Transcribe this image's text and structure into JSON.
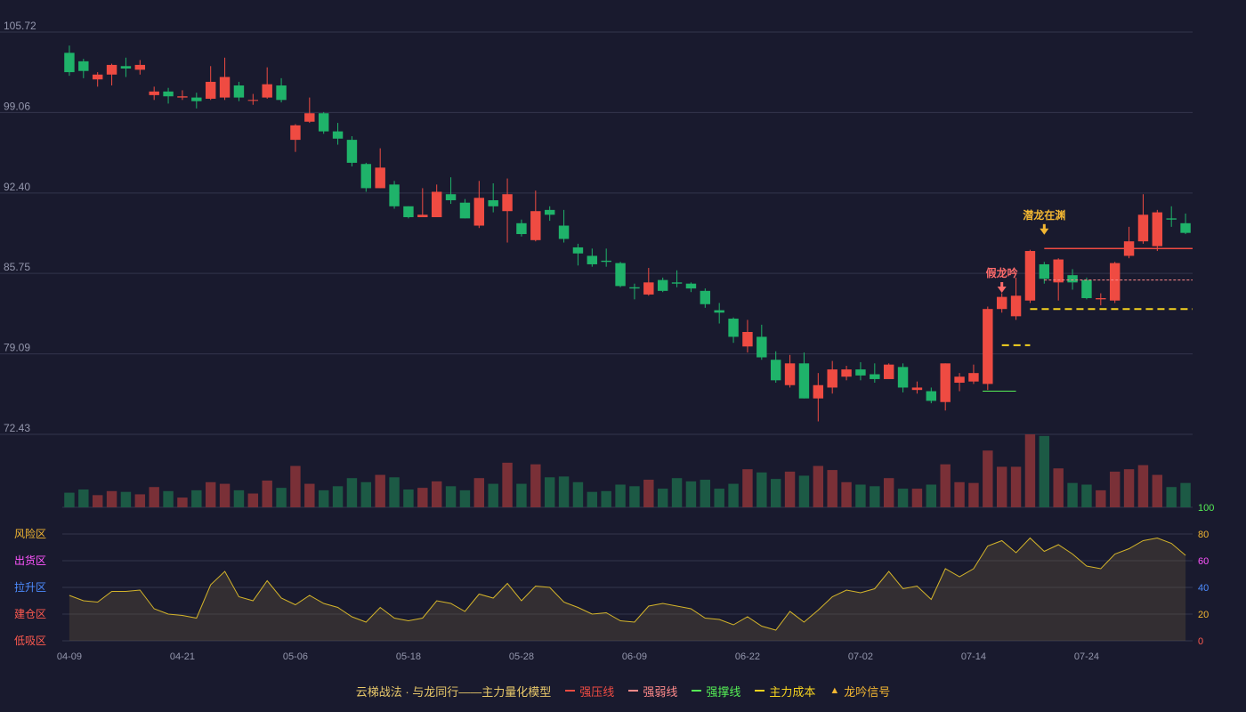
{
  "chart_data": {
    "type": "candlestick",
    "x": [
      "04-09",
      "04-10",
      "04-11",
      "04-12",
      "04-15",
      "04-16",
      "04-17",
      "04-18",
      "04-19",
      "04-22",
      "04-23",
      "04-24",
      "04-25",
      "04-26",
      "04-29",
      "04-30",
      "05-06",
      "05-07",
      "05-08",
      "05-09",
      "05-10",
      "05-13",
      "05-14",
      "05-15",
      "05-16",
      "05-17",
      "05-20",
      "05-21",
      "05-22",
      "05-23",
      "05-24",
      "05-27",
      "05-28",
      "05-29",
      "05-30",
      "05-31",
      "06-03",
      "06-04",
      "06-05",
      "06-06",
      "06-07",
      "06-11",
      "06-12",
      "06-13",
      "06-14",
      "06-17",
      "06-18",
      "06-19",
      "06-20",
      "06-21",
      "06-24",
      "06-25",
      "06-26",
      "06-27",
      "06-28",
      "07-01",
      "07-02",
      "07-03",
      "07-04",
      "07-05",
      "07-08",
      "07-09",
      "07-10",
      "07-11",
      "07-12",
      "07-15",
      "07-16",
      "07-17",
      "07-18",
      "07-19",
      "07-22",
      "07-23",
      "07-24",
      "07-25",
      "07-26",
      "07-29",
      "07-30",
      "07-31",
      "08-01",
      "08-02",
      "08-05",
      "08-06",
      "08-07",
      "08-08",
      "08-09"
    ],
    "x_ticks": [
      "04-09",
      "04-21",
      "05-06",
      "05-18",
      "05-28",
      "06-09",
      "06-22",
      "07-02",
      "07-14",
      "07-24"
    ],
    "x_tick_index": [
      0,
      8,
      16,
      24,
      32,
      40,
      48,
      56,
      64,
      72
    ],
    "candles": [
      [
        104.0,
        102.4,
        104.6,
        102.1
      ],
      [
        103.3,
        102.5,
        103.5,
        101.9
      ],
      [
        101.8,
        102.2,
        102.4,
        101.2
      ],
      [
        102.2,
        103.0,
        103.1,
        101.3
      ],
      [
        102.9,
        102.7,
        103.6,
        102.0
      ],
      [
        102.6,
        103.0,
        103.4,
        102.2
      ],
      [
        100.5,
        100.8,
        101.2,
        100.1
      ],
      [
        100.8,
        100.4,
        101.1,
        99.8
      ],
      [
        100.3,
        100.4,
        100.9,
        100.1
      ],
      [
        100.3,
        100.0,
        100.7,
        99.4
      ],
      [
        100.2,
        101.6,
        102.9,
        100.1
      ],
      [
        100.3,
        102.0,
        103.6,
        100.1
      ],
      [
        101.3,
        100.3,
        101.6,
        100.0
      ],
      [
        100.1,
        100.1,
        100.6,
        99.7
      ],
      [
        100.3,
        101.4,
        102.8,
        100.2
      ],
      [
        101.3,
        100.1,
        101.9,
        99.9
      ],
      [
        96.8,
        98.0,
        98.1,
        95.8
      ],
      [
        98.3,
        99.0,
        100.3,
        98.2
      ],
      [
        99.0,
        97.5,
        99.1,
        97.3
      ],
      [
        97.5,
        96.9,
        98.2,
        96.4
      ],
      [
        96.8,
        94.9,
        97.1,
        94.6
      ],
      [
        94.8,
        92.8,
        94.9,
        92.5
      ],
      [
        92.8,
        94.5,
        96.1,
        92.8
      ],
      [
        93.1,
        91.3,
        93.4,
        91.1
      ],
      [
        91.3,
        90.4,
        91.3,
        90.3
      ],
      [
        90.4,
        90.6,
        92.8,
        90.4
      ],
      [
        90.4,
        92.5,
        93.1,
        90.4
      ],
      [
        92.3,
        91.8,
        93.7,
        91.5
      ],
      [
        91.6,
        90.3,
        91.9,
        90.3
      ],
      [
        89.7,
        92.0,
        93.4,
        89.5
      ],
      [
        91.8,
        91.3,
        93.2,
        90.8
      ],
      [
        90.9,
        92.3,
        93.6,
        88.3
      ],
      [
        89.9,
        89.0,
        90.2,
        88.8
      ],
      [
        88.5,
        90.9,
        92.6,
        88.4
      ],
      [
        91.0,
        90.6,
        91.3,
        90.1
      ],
      [
        89.7,
        88.6,
        91.0,
        88.3
      ],
      [
        87.9,
        87.4,
        88.2,
        86.4
      ],
      [
        87.2,
        86.5,
        87.8,
        86.3
      ],
      [
        86.8,
        86.7,
        87.8,
        86.3
      ],
      [
        86.6,
        84.7,
        86.7,
        84.6
      ],
      [
        84.6,
        84.5,
        84.9,
        83.6
      ],
      [
        84.0,
        85.0,
        86.2,
        83.9
      ],
      [
        85.2,
        84.3,
        85.4,
        84.2
      ],
      [
        85.0,
        84.9,
        86.0,
        84.6
      ],
      [
        84.9,
        84.5,
        85.0,
        84.2
      ],
      [
        84.3,
        83.2,
        84.5,
        82.9
      ],
      [
        82.7,
        82.5,
        83.3,
        81.6
      ],
      [
        82.0,
        80.5,
        82.1,
        80.0
      ],
      [
        79.7,
        80.9,
        81.9,
        79.2
      ],
      [
        80.5,
        78.8,
        81.5,
        78.6
      ],
      [
        78.6,
        76.9,
        79.3,
        76.7
      ],
      [
        76.5,
        78.3,
        79.0,
        76.3
      ],
      [
        78.3,
        75.4,
        79.2,
        75.4
      ],
      [
        75.4,
        76.5,
        77.5,
        73.5
      ],
      [
        76.3,
        77.8,
        78.5,
        75.8
      ],
      [
        77.2,
        77.8,
        78.1,
        76.9
      ],
      [
        77.8,
        77.3,
        78.4,
        76.9
      ],
      [
        77.4,
        77.0,
        78.3,
        76.7
      ],
      [
        77.0,
        78.2,
        78.3,
        77.1
      ],
      [
        78.0,
        76.3,
        78.3,
        75.9
      ],
      [
        76.1,
        76.3,
        76.8,
        75.8
      ],
      [
        76.0,
        75.2,
        76.3,
        75.0
      ],
      [
        75.1,
        78.3,
        78.3,
        74.4
      ],
      [
        76.7,
        77.2,
        77.5,
        76.0
      ],
      [
        76.8,
        77.5,
        78.2,
        76.6
      ],
      [
        76.6,
        82.8,
        83.0,
        76.1
      ],
      [
        82.8,
        83.8,
        84.1,
        82.5
      ],
      [
        82.2,
        83.9,
        85.4,
        81.9
      ],
      [
        83.5,
        87.6,
        87.7,
        83.3
      ],
      [
        86.5,
        85.3,
        86.7,
        84.9
      ],
      [
        85.0,
        86.9,
        87.0,
        83.5
      ],
      [
        85.6,
        85.0,
        86.1,
        84.4
      ],
      [
        85.2,
        83.7,
        85.4,
        83.6
      ],
      [
        83.6,
        83.7,
        84.1,
        83.1
      ],
      [
        83.5,
        86.6,
        86.7,
        83.3
      ],
      [
        87.2,
        88.4,
        89.6,
        87.0
      ],
      [
        88.4,
        90.6,
        92.3,
        88.2
      ],
      [
        88.0,
        90.8,
        91.0,
        87.6
      ],
      [
        90.3,
        90.2,
        91.3,
        89.6
      ],
      [
        89.9,
        89.1,
        90.7,
        89.0
      ]
    ],
    "volume": [
      18,
      22,
      15,
      20,
      19,
      16,
      25,
      20,
      12,
      21,
      31,
      29,
      21,
      17,
      33,
      24,
      51,
      29,
      21,
      26,
      36,
      31,
      40,
      37,
      22,
      24,
      32,
      26,
      21,
      36,
      29,
      55,
      29,
      53,
      37,
      38,
      31,
      19,
      20,
      28,
      26,
      34,
      23,
      36,
      32,
      34,
      23,
      29,
      47,
      43,
      35,
      44,
      39,
      51,
      46,
      31,
      28,
      26,
      36,
      23,
      23,
      28,
      53,
      31,
      30,
      70,
      50,
      50,
      90,
      88,
      48,
      30,
      28,
      21,
      44,
      47,
      52,
      40,
      25,
      30
    ],
    "y_ticks": [
      "72.43",
      "79.09",
      "85.75",
      "92.40",
      "99.06",
      "105.72"
    ],
    "ylim": [
      72.43,
      105.72
    ],
    "lines": {
      "strong_pressure": {
        "from_index": 69,
        "to_index": 79,
        "value": 87.8
      },
      "strong_weak": {
        "from_index": 69,
        "to_index": 79,
        "value": 85.2
      },
      "strong_support": {
        "from_index": 65,
        "to_index": 67,
        "value": 76.0
      },
      "main_cost": [
        {
          "from_index": 66,
          "to_index": 68,
          "value": 79.8
        },
        {
          "from_index": 68,
          "to_index": 79,
          "value": 82.8
        }
      ]
    },
    "signals": [
      {
        "index": 66,
        "label": "假龙吟",
        "type": "fake",
        "color": "#ff6b6b",
        "value": 83.7
      },
      {
        "index": 69,
        "label": "潜龙在渊",
        "type": "real",
        "color": "#f2b632",
        "value": 88.5
      }
    ],
    "indicator": {
      "ylim": [
        0,
        100
      ],
      "y_ticks": [
        "0",
        "20",
        "40",
        "60",
        "80",
        "100"
      ],
      "zones": [
        "风险区",
        "出货区",
        "拉升区",
        "建仓区",
        "低吸区"
      ],
      "values": [
        34,
        30,
        29,
        37,
        37,
        38,
        24,
        20,
        19,
        17,
        42,
        52,
        33,
        30,
        45,
        32,
        27,
        34,
        28,
        25,
        18,
        14,
        25,
        17,
        15,
        17,
        30,
        28,
        22,
        35,
        32,
        43,
        30,
        41,
        40,
        29,
        25,
        20,
        21,
        15,
        14,
        26,
        28,
        26,
        24,
        17,
        16,
        12,
        18,
        11,
        8,
        22,
        14,
        23,
        33,
        38,
        36,
        39,
        52,
        39,
        41,
        31,
        54,
        48,
        54,
        71,
        75,
        66,
        77,
        67,
        72,
        65,
        56,
        54,
        65,
        69,
        75,
        77,
        73,
        64
      ]
    },
    "legend": {
      "title": "云梯战法 · 与龙同行——主力量化模型",
      "strong_pressure": "强压线",
      "strong_weak": "强弱线",
      "strong_support": "强撑线",
      "main_cost": "主力成本",
      "dragon_signal": "龙吟信号"
    },
    "colors": {
      "up": "#ef4b42",
      "down": "#1fb36a",
      "up_volume": "#7a3037",
      "down_volume": "#1c5a45",
      "indicator_line": "#d4b42a",
      "grid": "#33354c",
      "tick_label": "#9497ad",
      "background": "#191a2e"
    }
  }
}
